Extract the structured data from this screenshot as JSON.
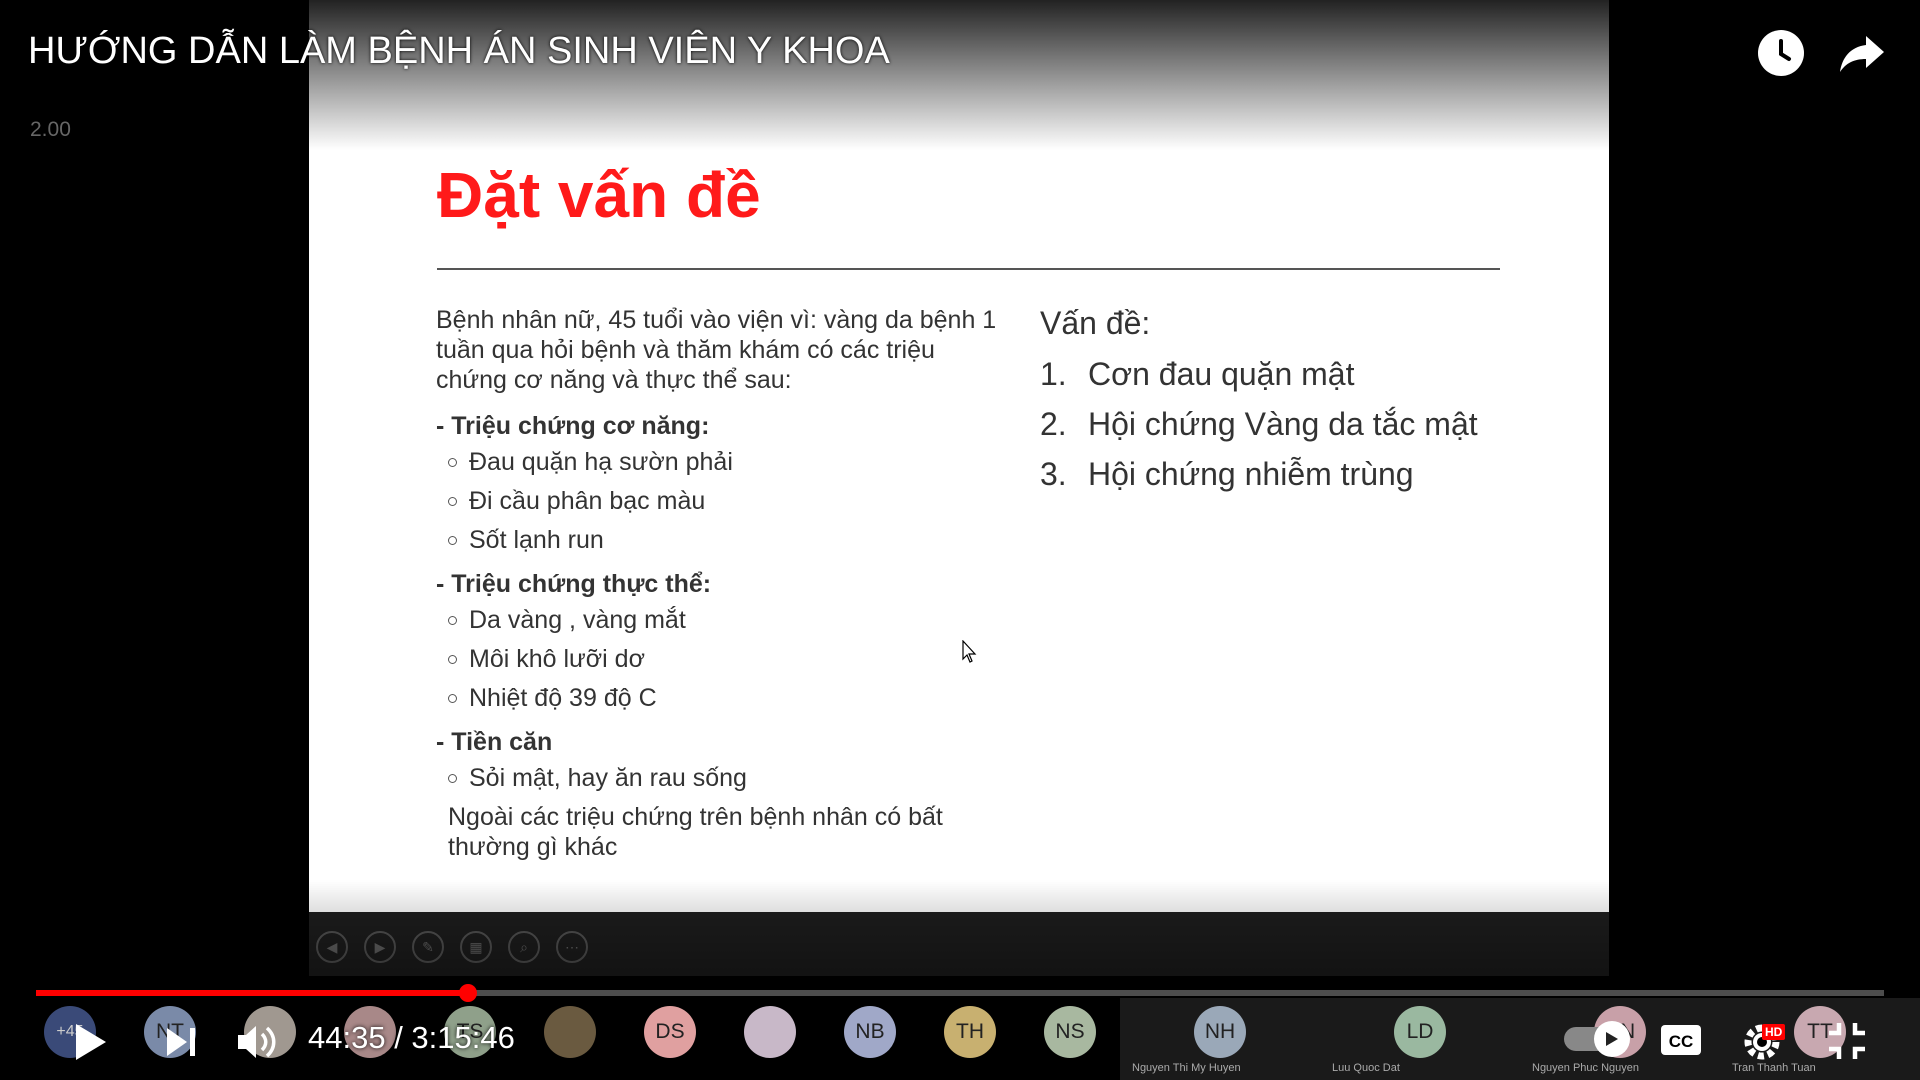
{
  "video": {
    "title": "HƯỚNG DẪN LÀM BỆNH ÁN SINH VIÊN Y KHOA",
    "speed": "2.00",
    "time": "44:35 / 3:15:46",
    "progress_fraction": 0.234
  },
  "slide": {
    "title": "Đặt vấn đề",
    "intro": "Bệnh nhân nữ, 45 tuổi vào viện vì: vàng da bệnh 1 tuần qua hỏi bệnh và thăm khám có các triệu chứng cơ năng và thực thể sau:",
    "sections": [
      {
        "heading": "- Triệu chứng cơ năng:",
        "items": [
          "Đau quặn hạ sườn phải",
          "Đi cầu phân bạc màu",
          "Sốt lạnh run"
        ]
      },
      {
        "heading": "- Triệu chứng thực thể:",
        "items": [
          "Da vàng , vàng mắt",
          "Môi khô lưỡi dơ",
          "Nhiệt độ 39 độ C"
        ]
      },
      {
        "heading": "- Tiền căn",
        "items": [
          "Sỏi mật, hay ăn rau sống"
        ]
      }
    ],
    "tail": "Ngoài các triệu chứng trên bệnh nhân có bất thường gì khác",
    "problems_heading": "Vấn đề:",
    "problems": [
      {
        "num": "1.",
        "text": "Cơn đau quặn mật"
      },
      {
        "num": "2.",
        "text": "Hội chứng Vàng da tắc mật"
      },
      {
        "num": "3.",
        "text": "Hội chứng nhiễm trùng"
      }
    ]
  },
  "participants": {
    "more_count": "+45",
    "avatars": [
      {
        "initials": "NT",
        "color": "#7a8aa8"
      },
      {
        "initials": "",
        "color": "#a09890"
      },
      {
        "initials": "",
        "color": "#a88888"
      },
      {
        "initials": "TS",
        "color": "#8fa08a"
      },
      {
        "initials": "",
        "color": "#6a5a40"
      },
      {
        "initials": "DS",
        "color": "#e0a0a0"
      },
      {
        "initials": "",
        "color": "#c8b8c8"
      },
      {
        "initials": "NB",
        "color": "#a0a8c8"
      },
      {
        "initials": "TH",
        "color": "#c8b070"
      },
      {
        "initials": "NS",
        "color": "#a8b8a0"
      }
    ],
    "named": [
      {
        "initials": "NH",
        "name": "Nguyen Thi My Huyen",
        "color": "#9aa8b8"
      },
      {
        "initials": "LD",
        "name": "Luu Quoc Dat",
        "color": "#9ab8a0"
      },
      {
        "initials": "NN",
        "name": "Nguyen Phuc Nguyen",
        "color": "#c8a0a8"
      },
      {
        "initials": "TT",
        "name": "Tran Thanh Tuan",
        "color": "#c8a8b0"
      }
    ]
  },
  "controls": {
    "hd_label": "HD"
  }
}
